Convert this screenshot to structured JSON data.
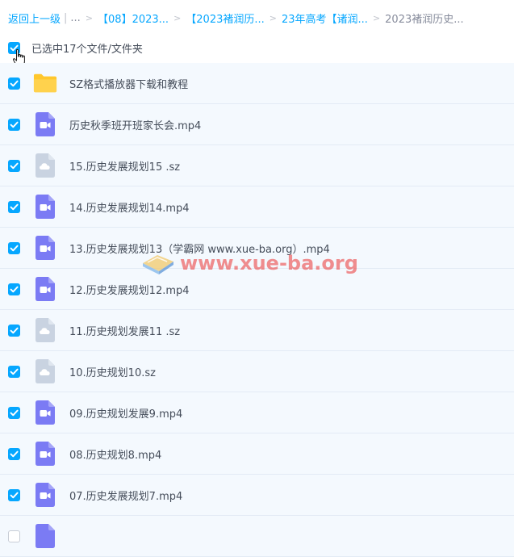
{
  "breadcrumb": {
    "back": "返回上一级",
    "ellipsis": "...",
    "items": [
      "【08】2023...",
      "【2023褚润历...",
      "23年高考【诸润..."
    ],
    "current": "2023褚润历史..."
  },
  "selection": {
    "text": "已选中17个文件/文件夹",
    "checked": true
  },
  "files": [
    {
      "name": "SZ格式播放器下载和教程",
      "type": "folder",
      "checked": true
    },
    {
      "name": "历史秋季班开班家长会.mp4",
      "type": "video",
      "checked": true
    },
    {
      "name": "15.历史发展规划15 .sz",
      "type": "cloud",
      "checked": true
    },
    {
      "name": "14.历史发展规划14.mp4",
      "type": "video",
      "checked": true
    },
    {
      "name": "13.历史发展规划13（学霸网 www.xue-ba.org）.mp4",
      "type": "video",
      "checked": true
    },
    {
      "name": "12.历史发展规划12.mp4",
      "type": "video",
      "checked": true
    },
    {
      "name": "11.历史规划发展11 .sz",
      "type": "cloud",
      "checked": true
    },
    {
      "name": "10.历史规划10.sz",
      "type": "cloud",
      "checked": true
    },
    {
      "name": "09.历史规划发展9.mp4",
      "type": "video",
      "checked": true
    },
    {
      "name": "08.历史规划8.mp4",
      "type": "video",
      "checked": true
    },
    {
      "name": "07.历史发展规划7.mp4",
      "type": "video",
      "checked": true
    },
    {
      "name": "",
      "type": "video",
      "checked": false
    }
  ],
  "watermark": {
    "text": "www.xue-ba.org"
  },
  "colors": {
    "accent": "#06a7ff",
    "folder": "#ffc72c",
    "video": "#7b7bf4",
    "cloud": "#c9d3e1",
    "row_bg": "#f4f9fe"
  }
}
